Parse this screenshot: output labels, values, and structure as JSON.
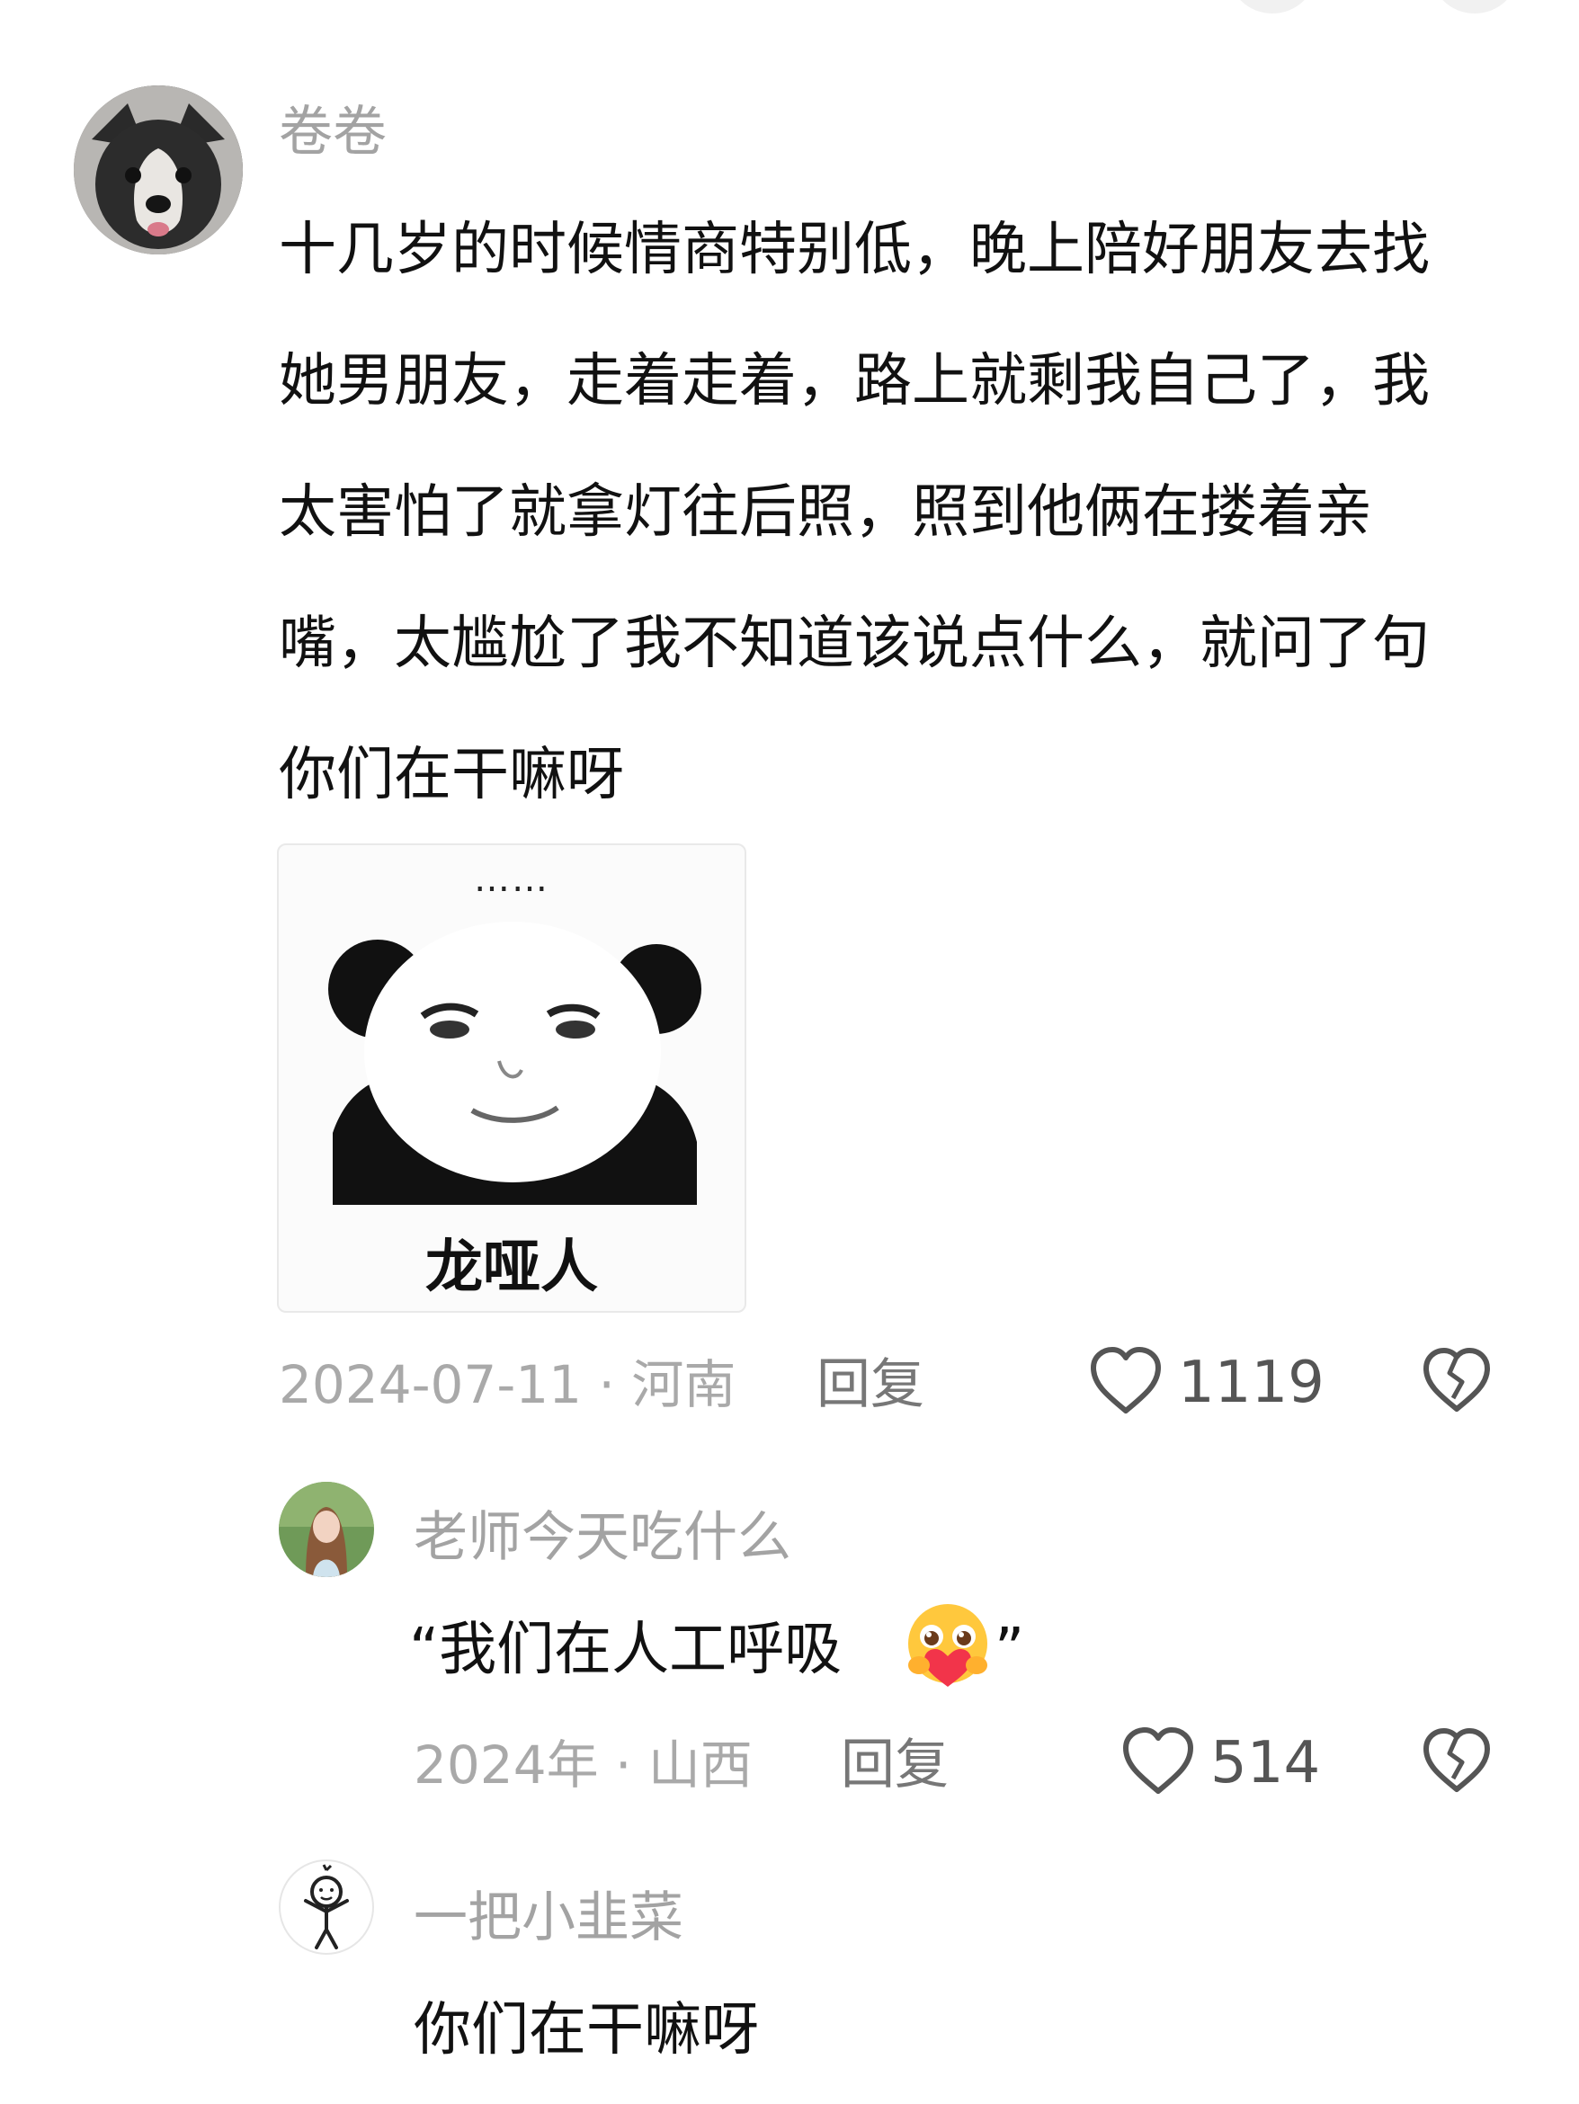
{
  "comments": [
    {
      "username": "卷卷",
      "text": "十几岁的时候情商特别低，晚上陪好朋友去找她男朋友，走着走着，路上就剩我自己了，我太害怕了就拿灯往后照，照到他俩在搂着亲嘴，太尴尬了我不知道该说点什么，就问了句你们在干嘛呀",
      "sticker": {
        "dots": "……",
        "caption": "龙哑人"
      },
      "date_location": "2024-07-11 · 河南",
      "reply_label": "回复",
      "likes": "1119",
      "replies": [
        {
          "username": "老师今天吃什么",
          "text": "“我们在人工呼吸",
          "text_end": "”",
          "emoji": "hugging-heart-emoji",
          "date_location": "2024年 · 山西",
          "reply_label": "回复",
          "likes": "514"
        },
        {
          "username": "一把小韭菜",
          "text": "你们在干嘛呀"
        }
      ]
    }
  ],
  "icons": {
    "like": "heart-outline-icon",
    "dislike": "broken-heart-icon"
  }
}
